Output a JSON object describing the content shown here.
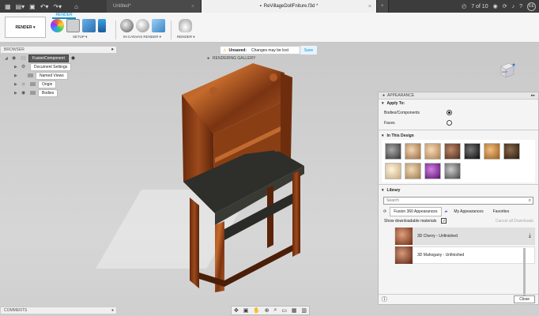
{
  "titlebar": {
    "tabs": [
      {
        "label": "Untitled*"
      },
      {
        "label": "ReVillageDollFniture.f3d *"
      }
    ],
    "page_counter": "7 of 10",
    "user_initials": "EE"
  },
  "ribbon": {
    "workspace": "RENDER ▾",
    "active_tab": "RENDER",
    "groups": [
      {
        "label": "SETUP ▾"
      },
      {
        "label": "IN-CANVAS RENDER ▾"
      },
      {
        "label": "RENDER ▾"
      }
    ]
  },
  "browser": {
    "title": "BROWSER",
    "root": "FusionComponent",
    "items": [
      {
        "label": "Document Settings"
      },
      {
        "label": "Named Views"
      },
      {
        "label": "Origin"
      },
      {
        "label": "Bodies"
      }
    ]
  },
  "unsaved": {
    "title": "Unsaved:",
    "message": "Changes may be lost",
    "save": "Save"
  },
  "rendering_gallery": "RENDERING GALLERY",
  "viewcube_label": "LEFT",
  "appearance": {
    "title": "APPEARANCE",
    "apply_to": "Apply To:",
    "bodies_option": "Bodies/Components",
    "faces_option": "Faces",
    "in_design": "In This Design",
    "swatch_colors": [
      "#555555",
      "#c9a27a",
      "#d8b38a",
      "#8a5a3c",
      "#1a1a1a",
      "#c89048",
      "#4a3020",
      "#e8d4b0",
      "#c8a878",
      "#8a3090",
      "#7a7a7a"
    ],
    "library": "Library",
    "search_placeholder": "Search",
    "lib_tabs": [
      "Fusion 360 Appearances",
      "My Appearances",
      "Favorites"
    ],
    "show_downloadable": "Show downloadable materials",
    "cancel_downloads": "Cancel all Downloads",
    "items": [
      {
        "label": "3D Cherry - Unfinished"
      },
      {
        "label": "3D Mahogany - Unfinished"
      }
    ],
    "close": "Close"
  },
  "comments": {
    "title": "COMMENTS"
  }
}
